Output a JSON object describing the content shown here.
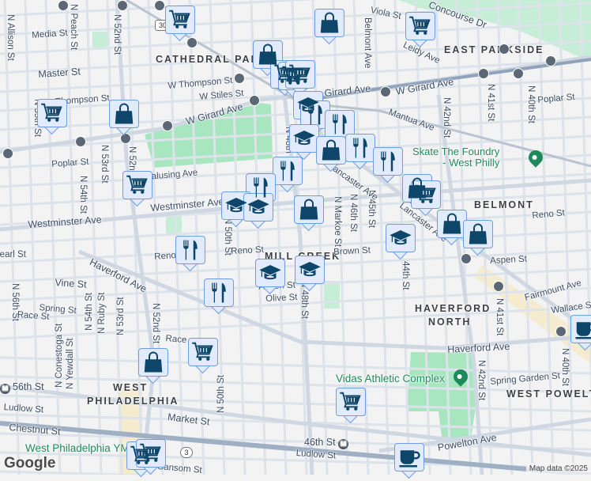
{
  "colors": {
    "marker_fill": "#e2ebfb",
    "marker_border": "#6e9de4",
    "icon": "#0d4668",
    "park": "#a8e6c0",
    "poi": "#1e8a5b",
    "road": "#d6dee7",
    "rail": "#9fb0c4"
  },
  "labels": [
    "N Allison St",
    "N Peach St",
    "N 52nd St",
    "Media St",
    "CATHEDRAL PARK",
    "Master St",
    "W Thompson St",
    "W Stiles St",
    "W Girard Ave",
    "Thompson St",
    "N 55th St",
    "Poplar St",
    "N 53rd St",
    "N 54th St",
    "N 52nd St",
    "Wyalusing Ave",
    "Westminster Ave",
    "Westminster Ave",
    "N 48th St",
    "Viola St",
    "Belmont Ave",
    "Concourse Dr",
    "Leidy Ave",
    "EAST PARKSIDE",
    "W Girard Ave",
    "N 41st St",
    "N 40th St",
    "Poplar St",
    "Mantua Ave",
    "N 42nd St",
    "BELMONT",
    "Reno St",
    "Lancaster Ave",
    "N Markoe St",
    "N 46th St",
    "N 45th St",
    "N 50th St",
    "Reno St",
    "Reno",
    "MILL CREEK",
    "Brown St",
    "Aspen St",
    "Fairmount Ave",
    "Wallace St",
    "44th St",
    "N 48th St",
    "N 41st St",
    "N 40th St",
    "Olive St",
    "Aspen St",
    "Pearl St",
    "Haverford Ave",
    "Vine St",
    "N 56th St",
    "Spring St",
    "Race St",
    "N 54th St",
    "N Ruby St",
    "N 53rd St",
    "N 52nd St",
    "N Conestoga St",
    "N Yewdall St",
    "Race",
    "N 50th St",
    "WEST",
    "PHILADELPHIA",
    "56th St",
    "Ludlow St",
    "Market St",
    "Chestnut St",
    "HAVERFORD",
    "NORTH",
    "Haverford Ave",
    "Spring Garden St",
    "N 42nd St",
    "WEST POWELTON",
    "46th St",
    "Ludlow St",
    "Powelton Ave",
    "Sansom St",
    "Lancaster Ave",
    "Girard Ave"
  ],
  "route_shields": [
    "30",
    "3"
  ],
  "pois": [
    {
      "name": "Skate The Foundry",
      "line2": "- West Philly"
    },
    {
      "name": "Vidas Athletic Complex"
    },
    {
      "name": "West Philadelphia YM"
    }
  ],
  "markers": [
    "cart",
    "bag",
    "cart",
    "bag",
    "cart",
    "cart",
    "cart",
    "bag",
    "school",
    "fork-knife",
    "fork-knife",
    "school",
    "bag",
    "fork-knife",
    "fork-knife",
    "fork-knife",
    "fork-knife",
    "school",
    "school",
    "cart",
    "bag",
    "bag",
    "cart",
    "bag",
    "bag",
    "school",
    "fork-knife",
    "school",
    "school",
    "fork-knife",
    "cart",
    "bag",
    "cart",
    "cart",
    "cart",
    "coffee",
    "coffee"
  ],
  "metro_icon": "M",
  "footer": {
    "logo": "Google",
    "attribution": "Map data ©2025"
  }
}
